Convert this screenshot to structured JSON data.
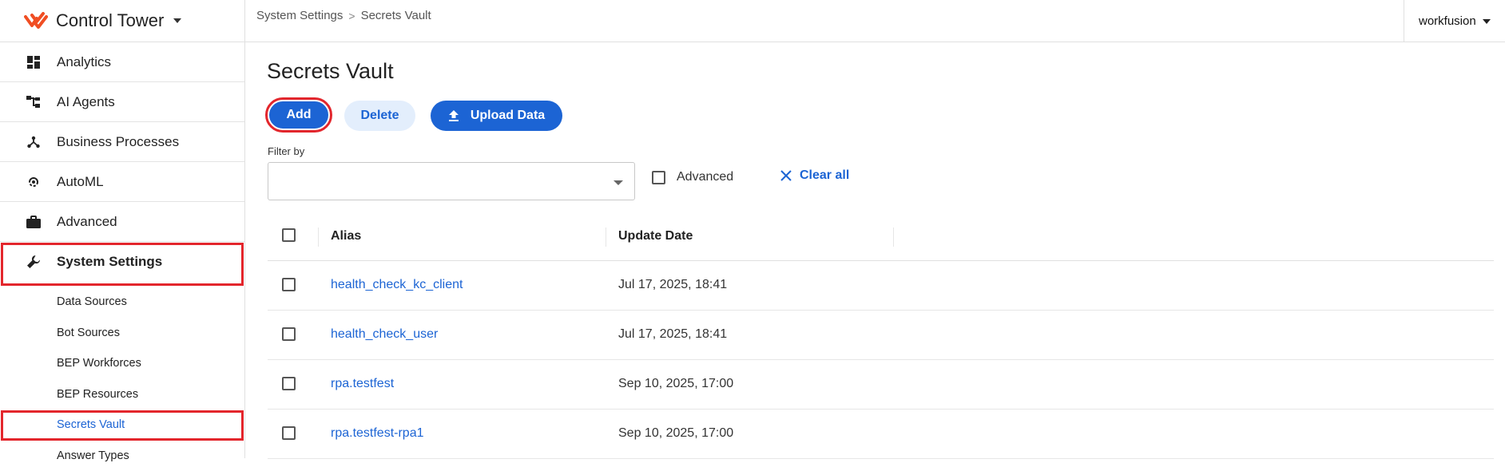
{
  "app": {
    "title": "Control Tower",
    "accent": "#1c64d4",
    "brand_color": "#f04e23",
    "highlight": "#e3262c"
  },
  "sidebar": {
    "items": [
      {
        "label": "Analytics",
        "icon": "dashboard-icon"
      },
      {
        "label": "AI Agents",
        "icon": "hierarchy-icon"
      },
      {
        "label": "Business Processes",
        "icon": "process-fork-icon"
      },
      {
        "label": "AutoML",
        "icon": "automl-icon"
      },
      {
        "label": "Advanced",
        "icon": "briefcase-icon"
      },
      {
        "label": "System Settings",
        "icon": "wrench-icon"
      }
    ],
    "sub_items": [
      {
        "label": "Data Sources"
      },
      {
        "label": "Bot Sources"
      },
      {
        "label": "BEP Workforces"
      },
      {
        "label": "BEP Resources"
      },
      {
        "label": "Secrets Vault"
      },
      {
        "label": "Answer Types"
      }
    ]
  },
  "breadcrumb": {
    "items": [
      "System Settings",
      "Secrets Vault"
    ],
    "separator": ">"
  },
  "user": {
    "name": "workfusion"
  },
  "main": {
    "title": "Secrets Vault",
    "buttons": {
      "add": "Add",
      "delete": "Delete",
      "upload": "Upload Data"
    },
    "filter": {
      "label": "Filter by",
      "value": ""
    },
    "advanced_label": "Advanced",
    "clear_all": "Clear all"
  },
  "table": {
    "columns": [
      "Alias",
      "Update Date"
    ],
    "rows": [
      {
        "alias": "health_check_kc_client",
        "date": "Jul 17, 2025, 18:41"
      },
      {
        "alias": "health_check_user",
        "date": "Jul 17, 2025, 18:41"
      },
      {
        "alias": "rpa.testfest",
        "date": "Sep 10, 2025, 17:00"
      },
      {
        "alias": "rpa.testfest-rpa1",
        "date": "Sep 10, 2025, 17:00"
      }
    ]
  }
}
